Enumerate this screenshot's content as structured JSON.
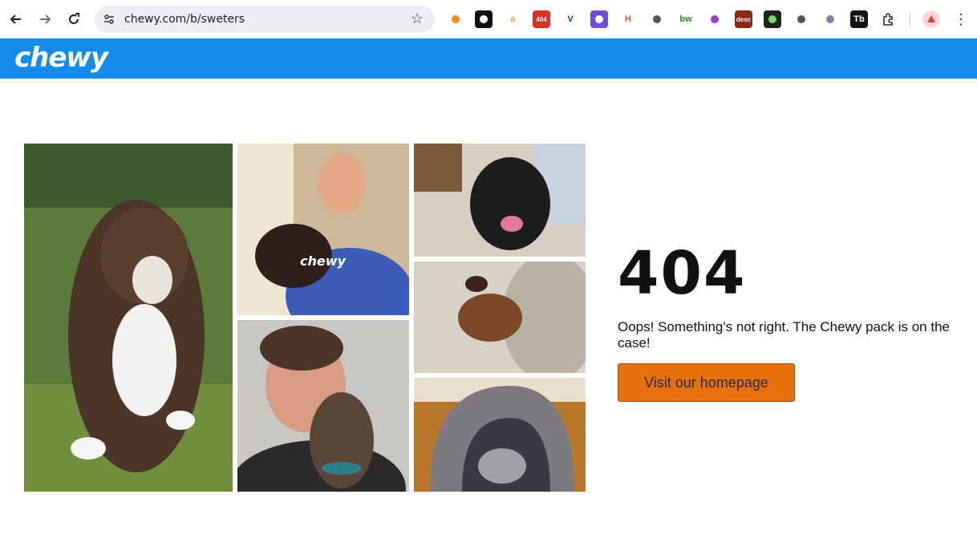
{
  "browser": {
    "url": "chewy.com/b/sweters",
    "icons": [
      "back-icon",
      "forward-icon",
      "reload-icon",
      "site-settings-icon",
      "bookmark-star-icon",
      "extensions-icon",
      "menu-icon"
    ],
    "extensions": [
      {
        "name": "ext-orange-leaf-icon",
        "label": "",
        "bg": "#ffffff",
        "color": "#f08a1c"
      },
      {
        "name": "ext-mask-icon",
        "label": "",
        "bg": "#111111",
        "color": "#ffffff"
      },
      {
        "name": "ext-amazon-icon",
        "label": "a",
        "bg": "#ffffff",
        "color": "#f39c12"
      },
      {
        "name": "ext-404-icon",
        "label": "404",
        "bg": "#d93025",
        "color": "#ffffff"
      },
      {
        "name": "ext-v-icon",
        "label": "V",
        "bg": "#ffffff",
        "color": "#1b3fa0"
      },
      {
        "name": "ext-gear-purple-icon",
        "label": "",
        "bg": "#6b4fd8",
        "color": "#ffffff"
      },
      {
        "name": "ext-htag-icon",
        "label": "H",
        "bg": "#ffffff",
        "color": "#d05050"
      },
      {
        "name": "ext-magnifier-icon",
        "label": "",
        "bg": "#ffffff",
        "color": "#555555"
      },
      {
        "name": "ext-bw-icon",
        "label": "bw",
        "bg": "#ffffff",
        "color": "#1f8a1f"
      },
      {
        "name": "ext-purple-flower-icon",
        "label": "",
        "bg": "#ffffff",
        "color": "#9b3ad6"
      },
      {
        "name": "ext-desc-icon",
        "label": "desc",
        "bg": "#8a2a10",
        "color": "#ffffff"
      },
      {
        "name": "ext-eye-icon",
        "label": "",
        "bg": "#222222",
        "color": "#7fd36b"
      },
      {
        "name": "ext-refresh-c-icon",
        "label": "",
        "bg": "#ffffff",
        "color": "#555555"
      },
      {
        "name": "ext-shield-icon",
        "label": "",
        "bg": "#ffffff",
        "color": "#7a86a8"
      },
      {
        "name": "ext-tb-icon",
        "label": "Tb",
        "bg": "#111111",
        "color": "#ffffff"
      }
    ]
  },
  "site": {
    "logo_text": "chewy",
    "brand_color": "#128bea"
  },
  "error": {
    "code": "404",
    "message": "Oops! Something's not right. The Chewy pack is on the case!",
    "button_label": "Visit our homepage",
    "button_color": "#e7700c"
  }
}
